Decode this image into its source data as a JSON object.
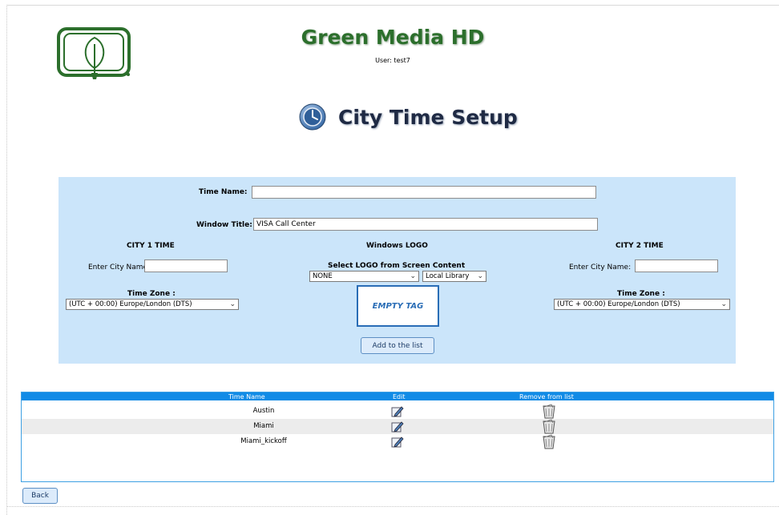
{
  "header": {
    "brand": "Green Media HD",
    "user": "User: test7",
    "page_title": "City Time Setup"
  },
  "form": {
    "time_name_label": "Time Name:",
    "time_name_value": "",
    "window_title_label": "Window Title:",
    "window_title_value": "VISA Call Center",
    "city1": {
      "heading": "CITY 1 TIME",
      "name_label": "Enter City Name:",
      "name_value": "",
      "tz_label": "Time Zone :",
      "tz_value": "(UTC + 00:00) Europe/London (DTS)"
    },
    "logo": {
      "heading": "Windows LOGO",
      "select_label": "Select LOGO from Screen Content",
      "logo_select_value": "NONE",
      "library_select_value": "Local Library",
      "preview_text": "EMPTY TAG"
    },
    "city2": {
      "heading": "CITY 2 TIME",
      "name_label": "Enter City Name:",
      "name_value": "",
      "tz_label": "Time Zone :",
      "tz_value": "(UTC + 00:00) Europe/London (DTS)"
    },
    "add_button": "Add to the list"
  },
  "list": {
    "columns": [
      "Time Name",
      "Edit",
      "Remove from list"
    ],
    "rows": [
      {
        "name": "Austin"
      },
      {
        "name": "Miami"
      },
      {
        "name": "Miami_kickoff"
      }
    ]
  },
  "footer": {
    "back_button": "Back"
  },
  "icons": {
    "logo": "green-media-leaf-logo-icon",
    "title": "clock-icon",
    "edit": "edit-pencil-icon",
    "remove": "trash-bin-icon"
  },
  "colors": {
    "brand_green": "#2c6f2c",
    "panel_blue": "#cbe5fa",
    "header_blue": "#118be6",
    "button_border": "#5d8fc4"
  }
}
